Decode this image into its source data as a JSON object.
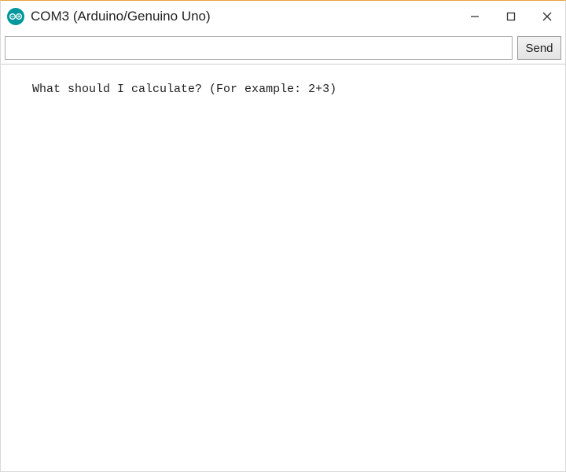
{
  "titlebar": {
    "title": "COM3 (Arduino/Genuino Uno)",
    "icon_name": "arduino-icon"
  },
  "win_controls": {
    "minimize": "minimize-icon",
    "maximize": "maximize-icon",
    "close": "close-icon"
  },
  "input_row": {
    "value": "",
    "placeholder": "",
    "send_label": "Send"
  },
  "output": {
    "lines": [
      "What should I calculate? (For example: 2+3)"
    ]
  },
  "colors": {
    "arduino_teal": "#00979d",
    "top_accent": "#e8a33d"
  }
}
